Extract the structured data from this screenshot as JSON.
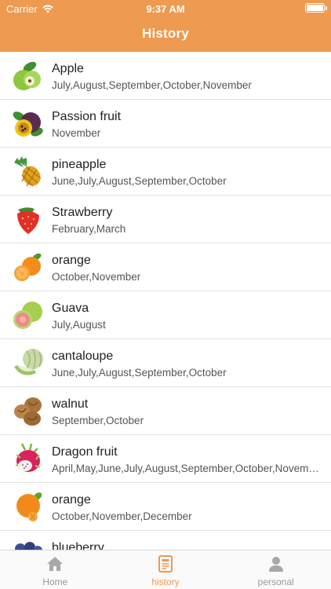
{
  "status": {
    "carrier": "Carrier",
    "time": "9:37 AM"
  },
  "header": {
    "title": "History"
  },
  "items": [
    {
      "name": "Apple",
      "months": "July,August,September,October,November",
      "icon": "apple-icon"
    },
    {
      "name": "Passion fruit",
      "months": "November",
      "icon": "passion-fruit-icon"
    },
    {
      "name": "pineapple",
      "months": "June,July,August,September,October",
      "icon": "pineapple-icon"
    },
    {
      "name": "Strawberry",
      "months": "February,March",
      "icon": "strawberry-icon"
    },
    {
      "name": "orange",
      "months": "October,November",
      "icon": "orange-icon"
    },
    {
      "name": "Guava",
      "months": "July,August",
      "icon": "guava-icon"
    },
    {
      "name": "cantaloupe",
      "months": "June,July,August,September,October",
      "icon": "cantaloupe-icon"
    },
    {
      "name": "walnut",
      "months": "September,October",
      "icon": "walnut-icon"
    },
    {
      "name": "Dragon fruit",
      "months": "April,May,June,July,August,September,October,November",
      "icon": "dragon-fruit-icon"
    },
    {
      "name": "orange",
      "months": "October,November,December",
      "icon": "orange-icon"
    },
    {
      "name": "blueberry",
      "months": "",
      "icon": "blueberry-icon"
    }
  ],
  "tabs": [
    {
      "label": "Home",
      "icon": "home-icon",
      "active": false
    },
    {
      "label": "history",
      "icon": "history-icon",
      "active": true
    },
    {
      "label": "personal",
      "icon": "person-icon",
      "active": false
    }
  ],
  "colors": {
    "accent": "#EE9A50",
    "inactive": "#9A9A9A"
  }
}
